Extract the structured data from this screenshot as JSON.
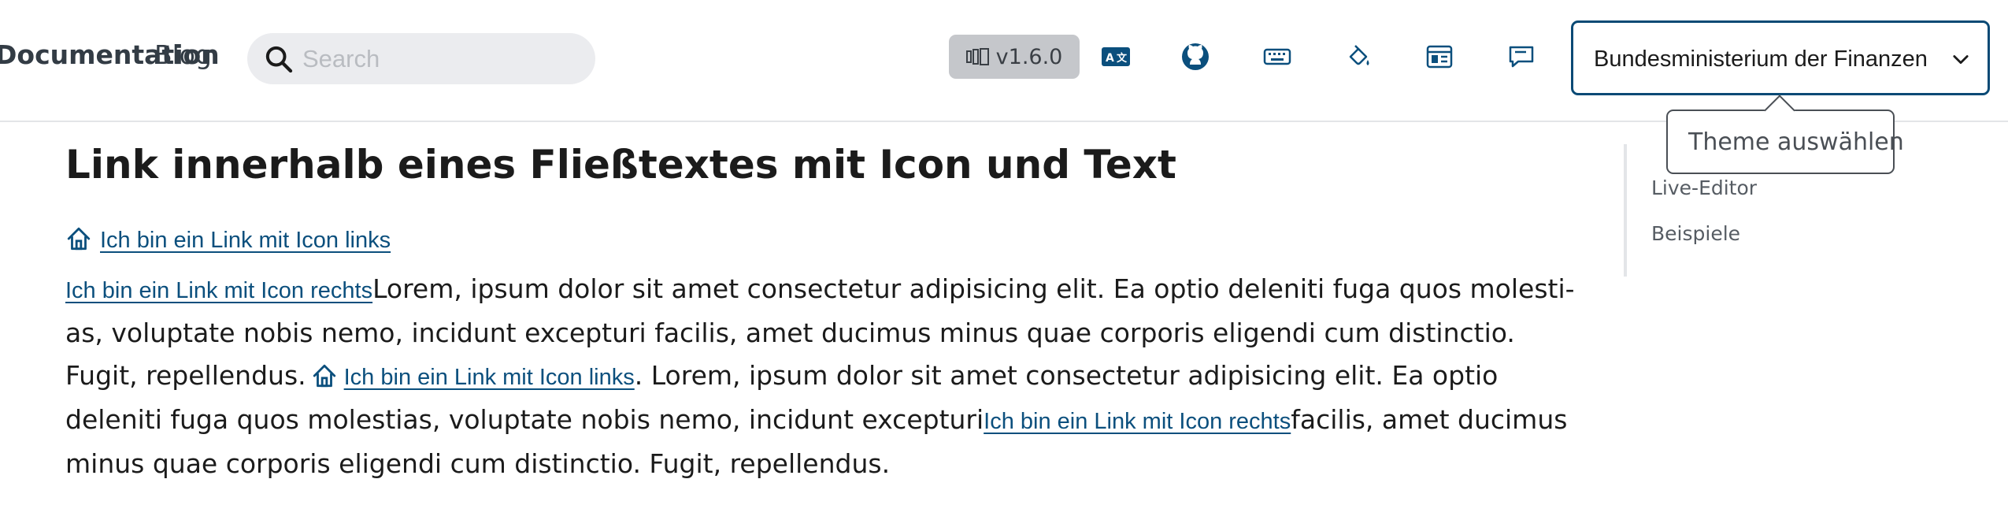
{
  "header": {
    "nav": {
      "docs_label": "Documentation",
      "blog_label": "Blog"
    },
    "search": {
      "placeholder": "Search",
      "value": ""
    },
    "version": "v1.6.0",
    "icons": [
      "translate-icon",
      "github-icon",
      "keyboard-icon",
      "paint-bucket-icon",
      "layout-icon",
      "feedback-icon"
    ],
    "theme_select": {
      "selected": "Bundesministerium der Finanzen"
    },
    "tooltip": "Theme auswählen"
  },
  "content": {
    "heading": "Link innerhalb eines Fließtextes mit Icon und Text",
    "link_left": "Ich bin ein Link mit Icon links",
    "link_right": "Ich bin ein Link mit Icon rechts",
    "para_text_1": "Lorem, ipsum dolor sit amet consectetur adipisicing elit. Ea optio deleniti fuga quos molesti­as, voluptate nobis nemo, incidunt excepturi facilis, amet ducimus minus quae corporis eligendi cum distinctio. Fugit, repellendus.",
    "para_text_2": ". Lorem, ipsum dolor sit amet consectetur adipisicing elit. Ea optio deleniti fuga quos molestias, voluptate nobis nemo, incidunt excepturi",
    "para_text_3": "facilis, amet ducimus minus quae corporis eligendi cum distinctio. Fugit, repellendus."
  },
  "toc": {
    "items": [
      "Live-Editor",
      "Beispiele"
    ]
  },
  "colors": {
    "link": "#0b4f7d",
    "select_border": "#0a4a75",
    "version_bg": "#c5c7cb",
    "search_bg": "#ebecef"
  }
}
